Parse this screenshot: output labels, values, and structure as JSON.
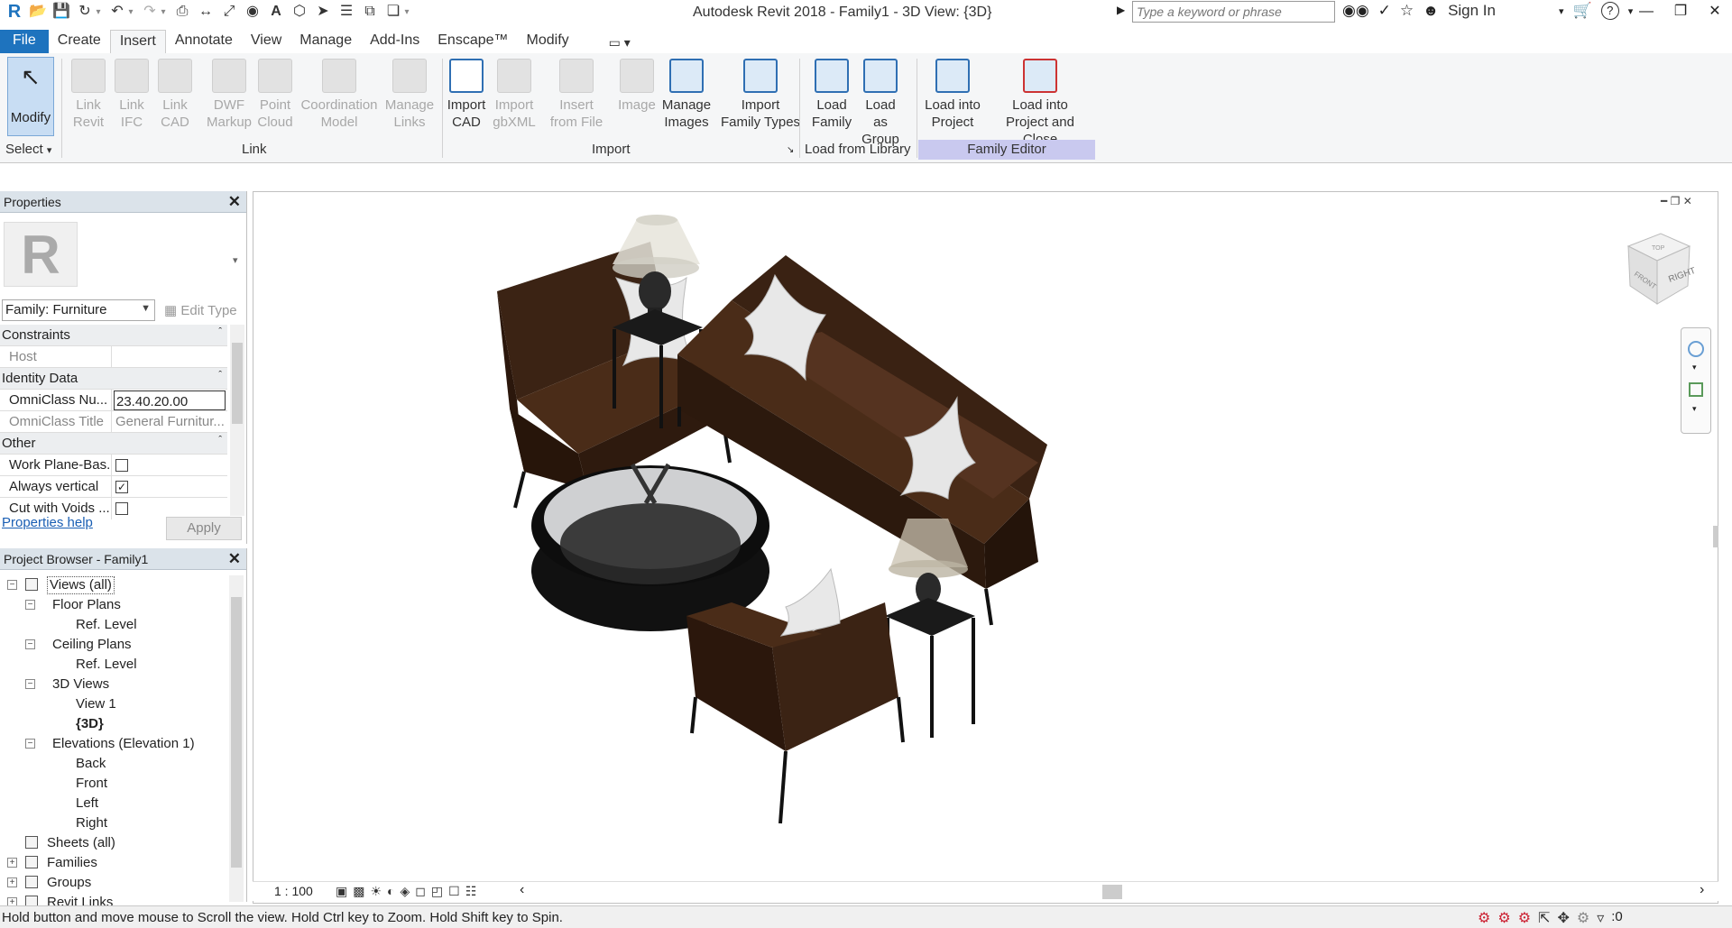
{
  "app": {
    "title": "Autodesk Revit 2018 -    Family1 - 3D View: {3D}",
    "search_placeholder": "Type a keyword or phrase",
    "sign_in": "Sign In"
  },
  "quick_access": [
    {
      "icon": "revit-logo-icon"
    },
    {
      "icon": "open-icon"
    },
    {
      "icon": "save-icon"
    },
    {
      "icon": "sync-icon"
    },
    {
      "icon": "undo-icon"
    },
    {
      "icon": "redo-icon"
    },
    {
      "icon": "print-icon"
    },
    {
      "icon": "measure-icon"
    },
    {
      "icon": "dimension-icon"
    },
    {
      "icon": "tag-icon"
    },
    {
      "icon": "text-icon"
    },
    {
      "icon": "3d-view-icon"
    },
    {
      "icon": "section-icon"
    },
    {
      "icon": "thin-lines-icon"
    },
    {
      "icon": "close-hidden-icon"
    },
    {
      "icon": "switch-windows-icon"
    }
  ],
  "tabs": [
    "File",
    "Create",
    "Insert",
    "Annotate",
    "View",
    "Manage",
    "Add-Ins",
    "Enscape™",
    "Modify"
  ],
  "active_tab": "Insert",
  "ribbon": {
    "modify": "Modify",
    "select": "Select",
    "link_buttons": [
      {
        "l1": "Link",
        "l2": "Revit"
      },
      {
        "l1": "Link",
        "l2": "IFC"
      },
      {
        "l1": "Link",
        "l2": "CAD"
      },
      {
        "l1": "DWF",
        "l2": "Markup"
      },
      {
        "l1": "Point",
        "l2": "Cloud"
      },
      {
        "l1": "Coordination",
        "l2": "Model"
      },
      {
        "l1": "Manage",
        "l2": "Links"
      }
    ],
    "link_panel": "Link",
    "import_buttons": [
      {
        "l1": "Import",
        "l2": "CAD",
        "enabled": true
      },
      {
        "l1": "Import",
        "l2": "gbXML",
        "enabled": false
      },
      {
        "l1": "Insert",
        "l2": "from File",
        "enabled": false
      },
      {
        "l1": "Image",
        "l2": "",
        "enabled": false
      },
      {
        "l1": "Manage",
        "l2": "Images",
        "enabled": true
      },
      {
        "l1": "Import",
        "l2": "Family Types",
        "enabled": true
      }
    ],
    "import_panel": "Import",
    "library_buttons": [
      {
        "l1": "Load",
        "l2": "Family"
      },
      {
        "l1": "Load as",
        "l2": "Group"
      }
    ],
    "library_panel": "Load from Library",
    "editor_buttons": [
      {
        "l1": "Load into",
        "l2": "Project"
      },
      {
        "l1": "Load into",
        "l2": "Project and Close"
      }
    ],
    "editor_panel": "Family Editor"
  },
  "properties": {
    "title": "Properties",
    "type_logo": "R",
    "family": "Family: Furniture",
    "edit_type": "Edit Type",
    "groups": {
      "constraints": "Constraints",
      "identity": "Identity Data",
      "other": "Other"
    },
    "rows": {
      "host": {
        "k": "Host",
        "v": ""
      },
      "omniclass_num": {
        "k": "OmniClass Nu...",
        "v": "23.40.20.00"
      },
      "omniclass_title": {
        "k": "OmniClass Title",
        "v": "General Furnitur..."
      },
      "work_plane": {
        "k": "Work Plane-Bas...",
        "checked": false
      },
      "always_vertical": {
        "k": "Always vertical",
        "checked": true
      },
      "cut_voids": {
        "k": "Cut with Voids ...",
        "checked": false
      }
    },
    "help": "Properties help",
    "apply": "Apply"
  },
  "browser": {
    "title": "Project Browser - Family1",
    "items": [
      {
        "label": "Views (all)",
        "level": 0,
        "toggle": "-",
        "icon": "views-icon"
      },
      {
        "label": "Floor Plans",
        "level": 1,
        "toggle": "-"
      },
      {
        "label": "Ref. Level",
        "level": 2
      },
      {
        "label": "Ceiling Plans",
        "level": 1,
        "toggle": "-"
      },
      {
        "label": "Ref. Level",
        "level": 2
      },
      {
        "label": "3D Views",
        "level": 1,
        "toggle": "-"
      },
      {
        "label": "View 1",
        "level": 2
      },
      {
        "label": "{3D}",
        "level": 2,
        "bold": true
      },
      {
        "label": "Elevations (Elevation 1)",
        "level": 1,
        "toggle": "-"
      },
      {
        "label": "Back",
        "level": 2
      },
      {
        "label": "Front",
        "level": 2
      },
      {
        "label": "Left",
        "level": 2
      },
      {
        "label": "Right",
        "level": 2
      },
      {
        "label": "Sheets (all)",
        "level": 0,
        "icon": "sheets-icon"
      },
      {
        "label": "Families",
        "level": 0,
        "toggle": "+",
        "icon": "families-icon"
      },
      {
        "label": "Groups",
        "level": 0,
        "toggle": "+",
        "icon": "groups-icon"
      },
      {
        "label": "Revit Links",
        "level": 0,
        "toggle": "+",
        "icon": "links-icon"
      }
    ]
  },
  "viewport": {
    "viewcube_labels": [
      "TOP",
      "FRONT",
      "RIGHT"
    ],
    "scale": "1 : 100"
  },
  "status": {
    "text": "Hold button and move mouse to Scroll the view. Hold Ctrl key to Zoom. Hold Shift key to Spin.",
    "filter_count": ":0"
  },
  "colors": {
    "file_tab": "#1e73be",
    "family_editor_panel": "#c9c9ef",
    "furniture_brown": "#3b2314"
  }
}
